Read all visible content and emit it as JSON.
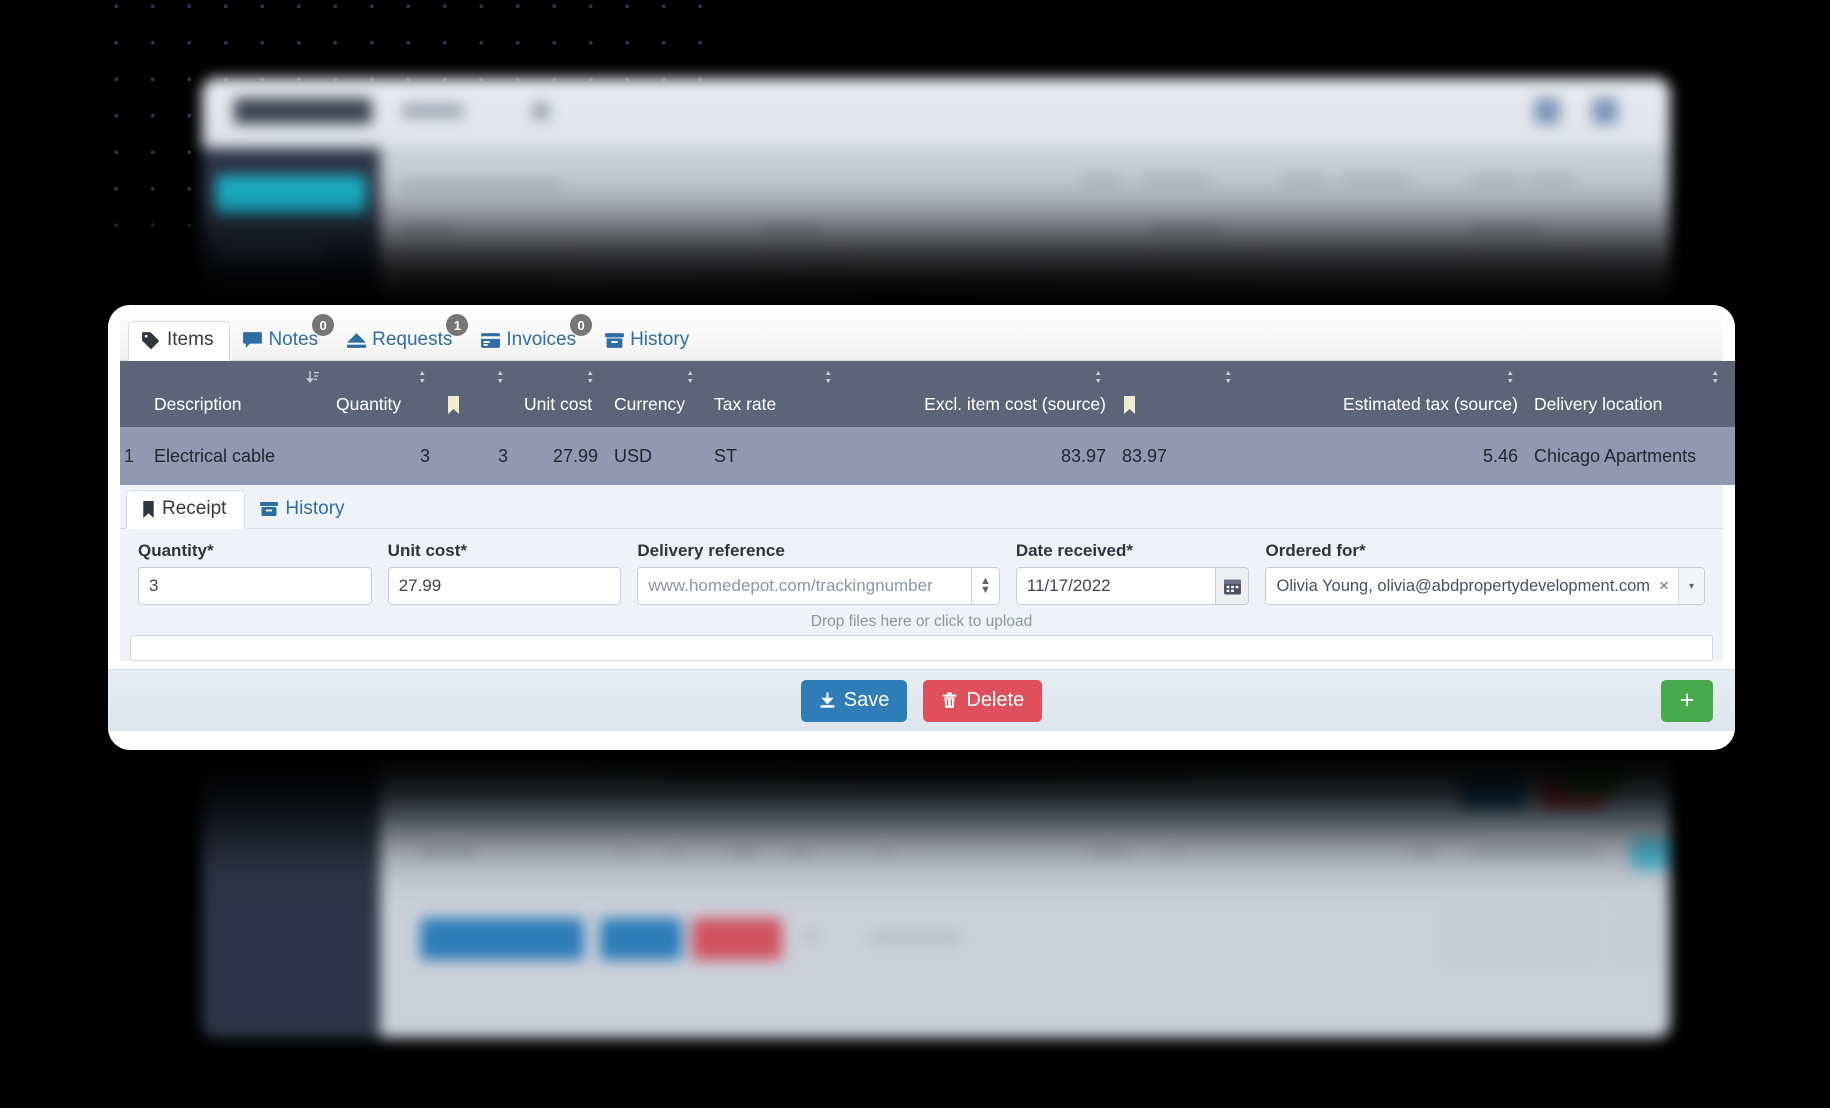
{
  "window": {
    "brand_color": "#1fc0d8",
    "sidebar_color": "#2d3648"
  },
  "tabs": [
    {
      "label": "Items",
      "icon": "tag-icon",
      "badge": null,
      "active": true
    },
    {
      "label": "Notes",
      "icon": "comment-icon",
      "badge": "0",
      "active": false
    },
    {
      "label": "Requests",
      "icon": "upload-icon",
      "badge": "1",
      "active": false
    },
    {
      "label": "Invoices",
      "icon": "invoice-icon",
      "badge": "0",
      "active": false
    },
    {
      "label": "History",
      "icon": "archive-icon",
      "badge": null,
      "active": false
    }
  ],
  "items_table": {
    "columns": [
      {
        "label": "Description",
        "align": "left",
        "sort": "sort-desc-icon",
        "sort_side": "right"
      },
      {
        "label": "Quantity",
        "align": "left",
        "sort": "sort-icon",
        "sort_side": "right"
      },
      {
        "label": "",
        "align": "left",
        "sort": "sort-icon",
        "sort_side": "right",
        "icon": "flag-icon"
      },
      {
        "label": "Unit cost",
        "align": "left",
        "sort": "sort-icon",
        "sort_side": "right"
      },
      {
        "label": "Currency",
        "align": "left",
        "sort": "sort-icon",
        "sort_side": "right"
      },
      {
        "label": "Tax rate",
        "align": "left",
        "sort": "sort-icon",
        "sort_side": "right"
      },
      {
        "label": "Excl. item cost (source)",
        "align": "right",
        "sort": "sort-icon",
        "sort_side": "right"
      },
      {
        "label": "",
        "align": "left",
        "sort": "sort-icon",
        "sort_side": "right",
        "icon": "flag-icon"
      },
      {
        "label": "Estimated tax (source)",
        "align": "right",
        "sort": "sort-icon",
        "sort_side": "right"
      },
      {
        "label": "Delivery location",
        "align": "left",
        "sort": "sort-icon",
        "sort_side": "right"
      },
      {
        "label": "",
        "align": "left",
        "sort": null
      }
    ],
    "rows": [
      {
        "index": "1",
        "description": "Electrical cable",
        "quantity": "3",
        "flag_quantity": "3",
        "unit_cost": "27.99",
        "currency": "USD",
        "tax_rate": "ST",
        "excl_item_cost_source": "83.97",
        "flag_cost": "83.97",
        "estimated_tax_source": "5.46",
        "delivery_location": "Chicago Apartments",
        "info_icon": "info-icon",
        "ban_icon": "ban-icon"
      }
    ]
  },
  "sub_tabs": [
    {
      "label": "Receipt",
      "icon": "flag-icon",
      "active": true
    },
    {
      "label": "History",
      "icon": "archive-icon",
      "active": false
    }
  ],
  "receipt_form": {
    "quantity": {
      "label": "Quantity*",
      "value": "3",
      "placeholder": ""
    },
    "unit_cost": {
      "label": "Unit cost*",
      "value": "27.99",
      "placeholder": ""
    },
    "delivery_reference": {
      "label": "Delivery reference",
      "value": "",
      "placeholder": "www.homedepot.com/trackingnumber"
    },
    "date_received": {
      "label": "Date received*",
      "value": "11/17/2022",
      "placeholder": "",
      "icon": "calendar-icon"
    },
    "ordered_for": {
      "label": "Ordered for*",
      "value": "Olivia Young, olivia@abdpropertydevelopment.com",
      "clear": "×",
      "arrow": "▾"
    },
    "dropzone_label": "Drop files here or click to upload"
  },
  "footer": {
    "save_label": "Save",
    "save_icon": "download-icon",
    "delete_label": "Delete",
    "delete_icon": "trash-icon",
    "add_label": "+",
    "add_icon": "plus-icon"
  }
}
